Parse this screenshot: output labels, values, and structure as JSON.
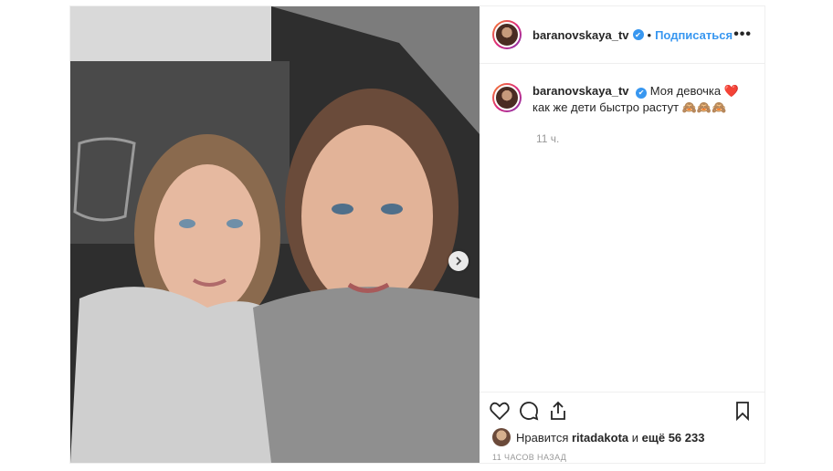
{
  "header": {
    "username": "baranovskaya_tv",
    "verified_mark": "✔",
    "separator": "•",
    "follow_label": "Подписаться",
    "more_label": "•••"
  },
  "caption": {
    "username": "baranovskaya_tv",
    "line1": "Моя девочка ❤️",
    "line2": "как же дети быстро растут 🙈🙈🙈",
    "time": "11 ч."
  },
  "likes": {
    "prefix": "Нравится",
    "user": "ritadakota",
    "middle": "и",
    "count": "ещё 56 233"
  },
  "posted_ago": "11 ЧАСОВ НАЗАД",
  "icons": [
    "heart-icon",
    "comment-icon",
    "share-icon",
    "bookmark-icon",
    "chevron-right-icon"
  ]
}
